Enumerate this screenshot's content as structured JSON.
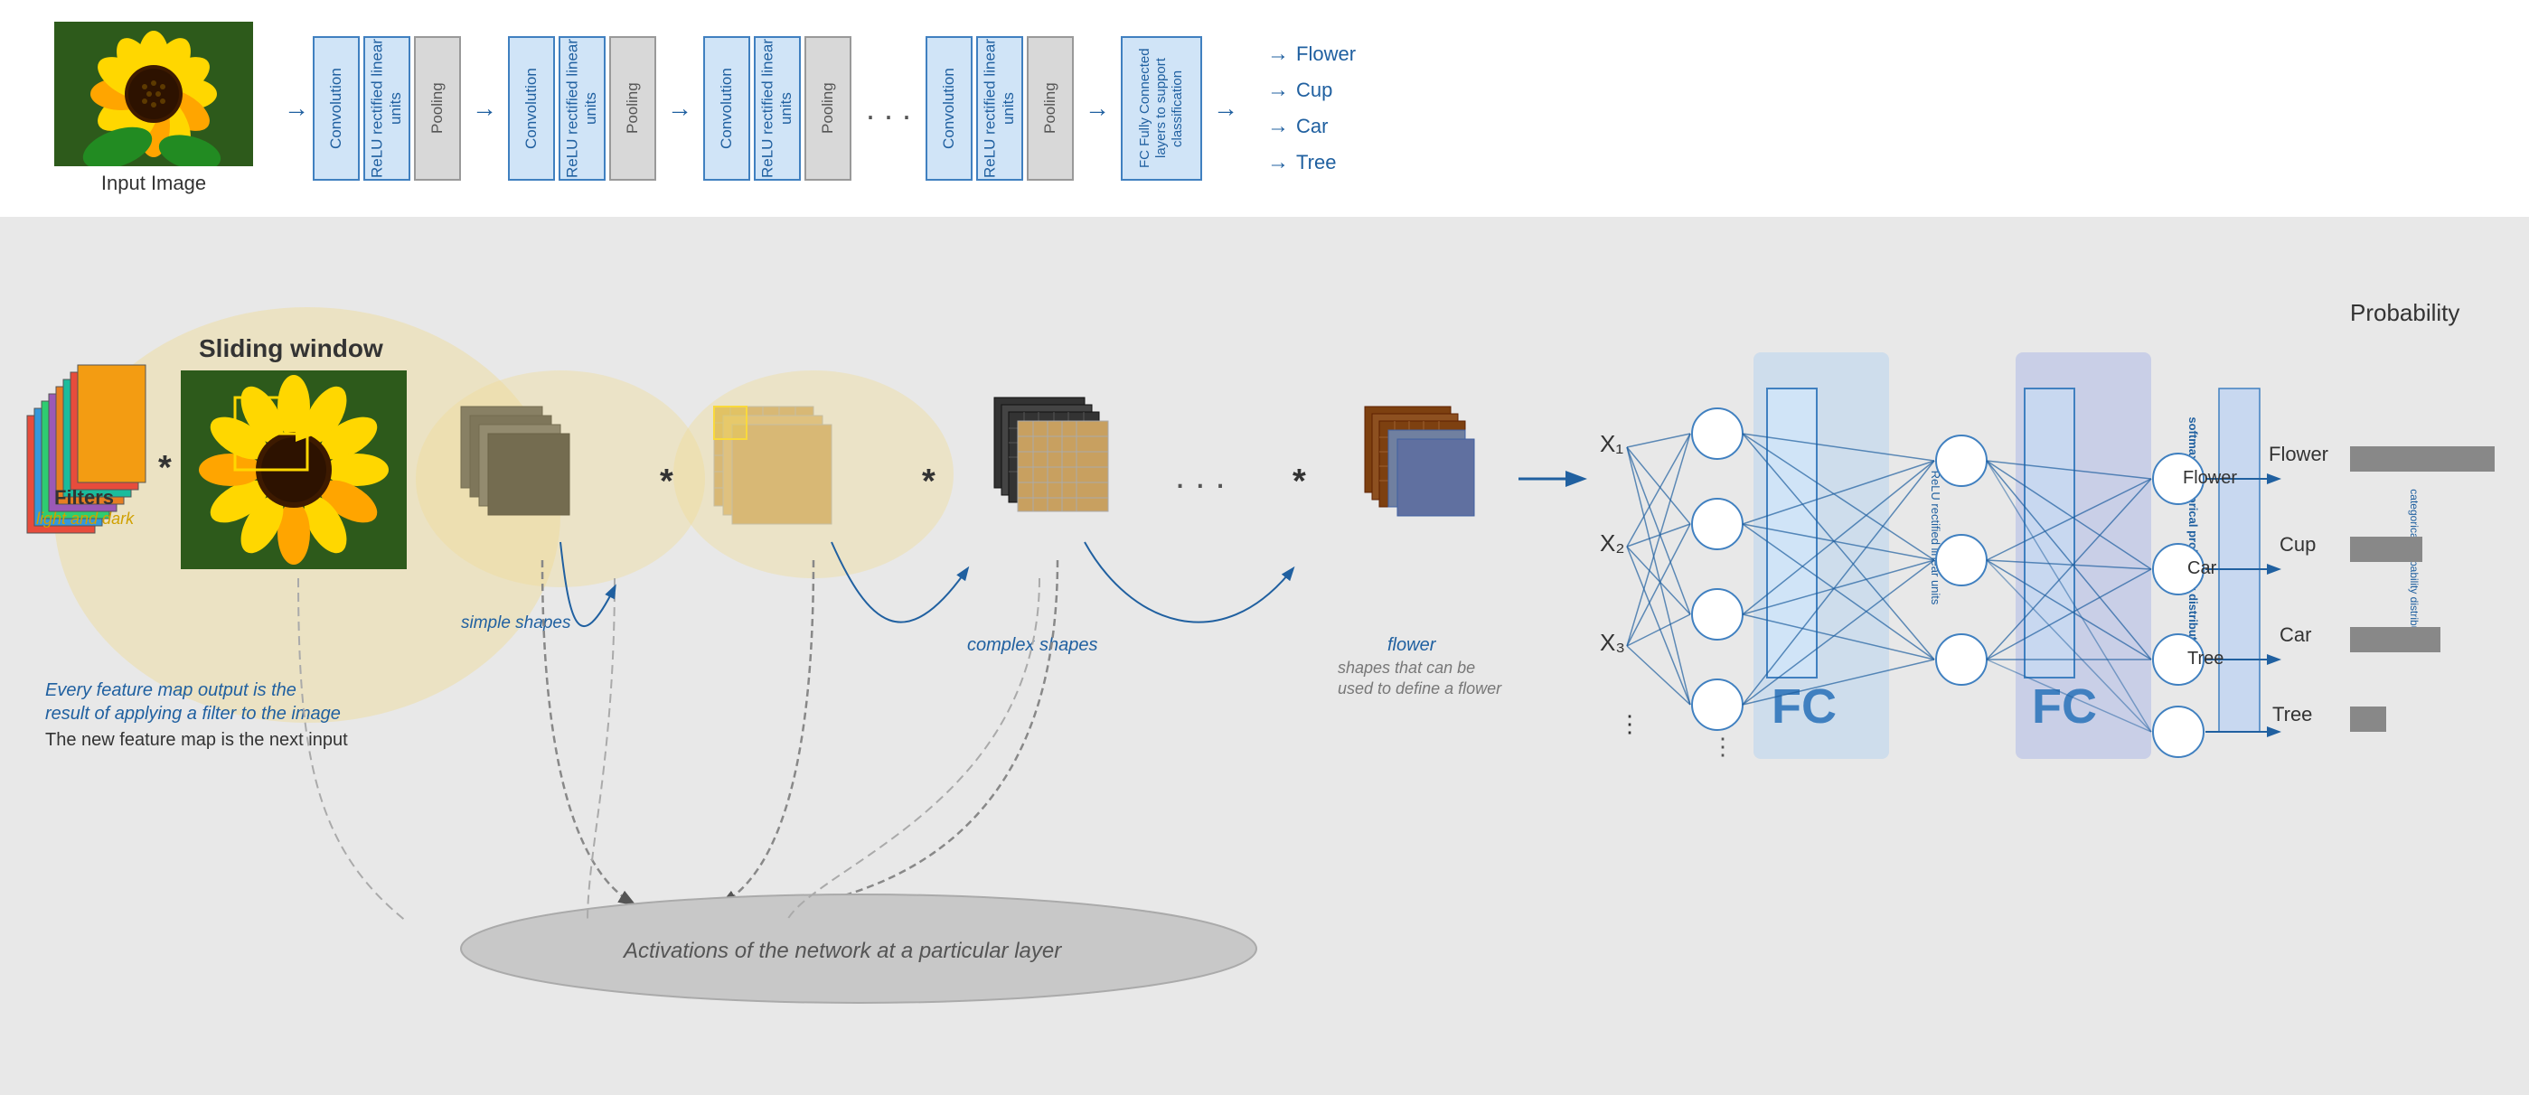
{
  "top": {
    "input_label": "Input Image",
    "cnn_groups": [
      {
        "blocks": [
          "Convolution",
          "ReLU rectified linear units",
          "Pooling"
        ]
      },
      {
        "blocks": [
          "Convolution",
          "ReLU rectified linear units",
          "Pooling"
        ]
      },
      {
        "blocks": [
          "Convolution",
          "ReLU rectified linear units",
          "Pooling"
        ]
      },
      {
        "blocks": [
          "Convolution",
          "ReLU rectified linear units",
          "Pooling"
        ]
      }
    ],
    "fc_label": "FC\nFully Connected layers to support classification",
    "outputs": [
      "Flower",
      "Cup",
      "Car",
      "Tree"
    ]
  },
  "bottom": {
    "sliding_window_label": "Sliding window",
    "filters_label": "Filters",
    "filters_sublabel": "light and dark",
    "star_op": "*",
    "dots": "...",
    "feature_labels": [
      "simple shapes",
      "complex shapes",
      "shapes that can be\nused to define a flower"
    ],
    "feature_text1": "Every feature map output is the\nresult of applying a filter to the image",
    "feature_text2": "The new feature map is the next input",
    "activations_label": "Activations of the network at a particular layer",
    "x_labels": [
      "X₁",
      "X₂",
      "X₃"
    ],
    "fc_labels": [
      "FC",
      "FC"
    ],
    "relu_text": "ReLU\nrectified linear units",
    "softmax_text": "softmax\ncategorical probability distribution",
    "probability_title": "Probability",
    "prob_items": [
      {
        "name": "Flower",
        "width": 160
      },
      {
        "name": "Cup",
        "width": 80
      },
      {
        "name": "Car",
        "width": 100
      },
      {
        "name": "Tree",
        "width": 40
      }
    ],
    "flower_label": "flower"
  }
}
